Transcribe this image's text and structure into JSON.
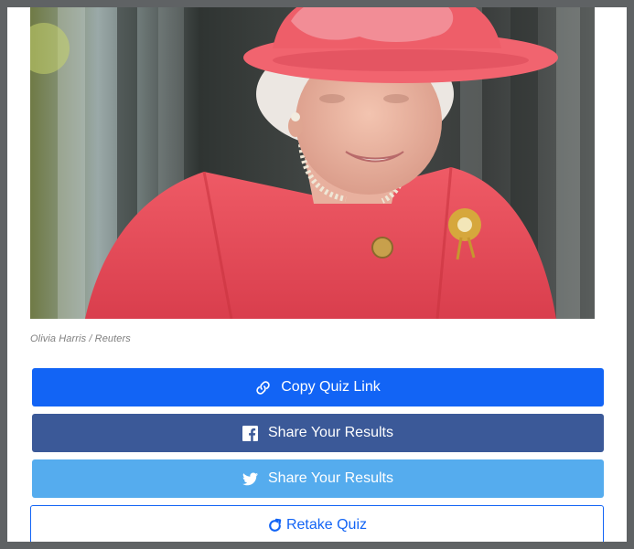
{
  "photo": {
    "alt": "Queen Elizabeth II in a pink coat and hat",
    "credit": "Olivia Harris / Reuters"
  },
  "buttons": {
    "copy_link": {
      "label": "Copy Quiz Link",
      "icon": "link-icon"
    },
    "facebook_share": {
      "label": "Share Your Results",
      "icon": "facebook-icon"
    },
    "twitter_share": {
      "label": "Share Your Results",
      "icon": "twitter-icon"
    },
    "retake": {
      "label": "Retake Quiz",
      "icon": "refresh-icon"
    }
  },
  "colors": {
    "copy_button": "#1264f5",
    "facebook_button": "#3b5998",
    "twitter_button": "#55acee",
    "retake_border": "#1264f5",
    "page_border": "#5f6264"
  }
}
